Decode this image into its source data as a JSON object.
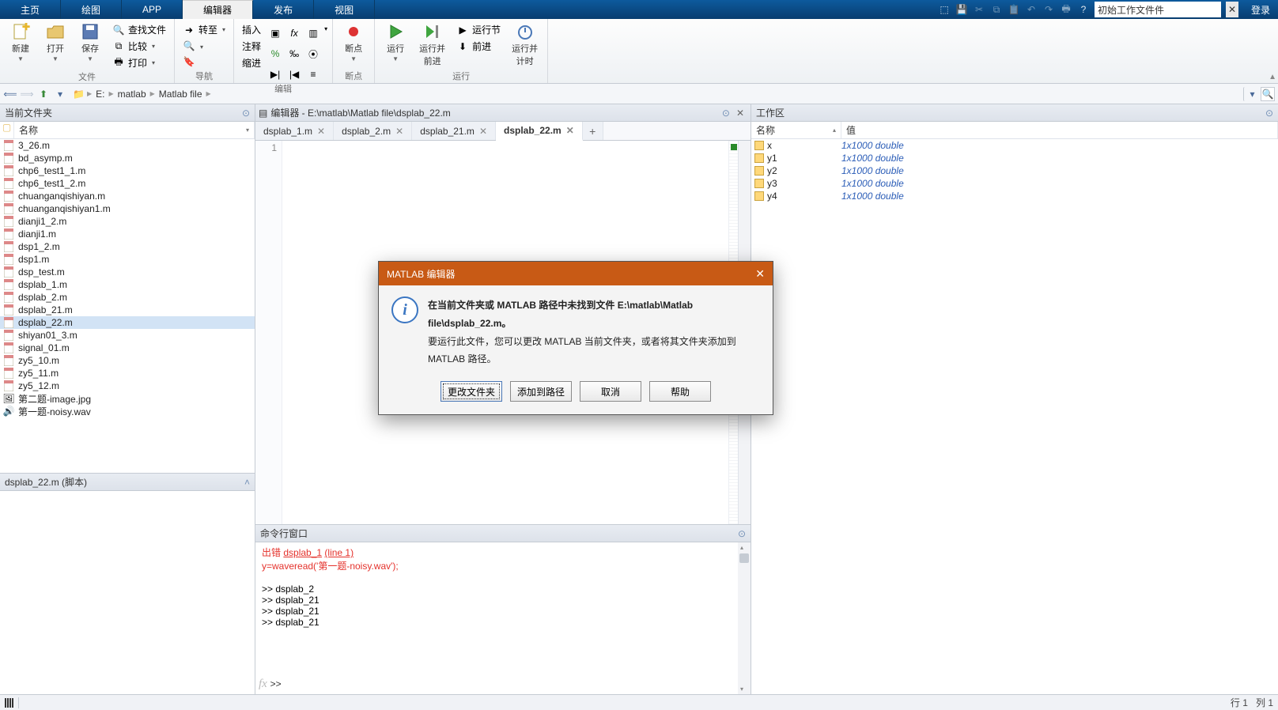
{
  "menu": {
    "tabs": [
      "主页",
      "绘图",
      "APP",
      "编辑器",
      "发布",
      "视图"
    ],
    "active": 3,
    "search_value": "初始工作文件件",
    "login": "登录"
  },
  "ribbon": {
    "file": {
      "label": "文件",
      "new": "新建",
      "open": "打开",
      "save": "保存",
      "findfiles": "查找文件",
      "compare": "比较",
      "print": "打印"
    },
    "nav": {
      "label": "导航",
      "goto": "转至"
    },
    "edit": {
      "label": "编辑",
      "insert": "插入",
      "comment": "注释",
      "indent": "缩进"
    },
    "bp": {
      "label": "断点",
      "bp": "断点"
    },
    "run": {
      "label": "运行",
      "run": "运行",
      "run_advance": "运行并\n前进",
      "run_section": "运行节",
      "advance": "前进",
      "run_time": "运行并\n计时"
    }
  },
  "address": {
    "crumbs": [
      "E:",
      "matlab",
      "Matlab file"
    ]
  },
  "current_folder": {
    "title": "当前文件夹",
    "col_name": "名称",
    "items": [
      {
        "name": "3_26.m",
        "type": "m"
      },
      {
        "name": "bd_asymp.m",
        "type": "m"
      },
      {
        "name": "chp6_test1_1.m",
        "type": "m"
      },
      {
        "name": "chp6_test1_2.m",
        "type": "m"
      },
      {
        "name": "chuanganqishiyan.m",
        "type": "m"
      },
      {
        "name": "chuanganqishiyan1.m",
        "type": "m"
      },
      {
        "name": "dianji1_2.m",
        "type": "m"
      },
      {
        "name": "dianji1.m",
        "type": "m"
      },
      {
        "name": "dsp1_2.m",
        "type": "m"
      },
      {
        "name": "dsp1.m",
        "type": "m"
      },
      {
        "name": "dsp_test.m",
        "type": "m"
      },
      {
        "name": "dsplab_1.m",
        "type": "m"
      },
      {
        "name": "dsplab_2.m",
        "type": "m"
      },
      {
        "name": "dsplab_21.m",
        "type": "m"
      },
      {
        "name": "dsplab_22.m",
        "type": "m",
        "selected": true
      },
      {
        "name": "shiyan01_3.m",
        "type": "m"
      },
      {
        "name": "signal_01.m",
        "type": "m"
      },
      {
        "name": "zy5_10.m",
        "type": "m"
      },
      {
        "name": "zy5_11.m",
        "type": "m"
      },
      {
        "name": "zy5_12.m",
        "type": "m"
      },
      {
        "name": "第二题-image.jpg",
        "type": "img"
      },
      {
        "name": "第一题-noisy.wav",
        "type": "wav"
      }
    ],
    "detail": "dsplab_22.m  (脚本)"
  },
  "editor": {
    "title": "编辑器 - E:\\matlab\\Matlab file\\dsplab_22.m",
    "tabs": [
      "dsplab_1.m",
      "dsplab_2.m",
      "dsplab_21.m",
      "dsplab_22.m"
    ],
    "active": 3,
    "line": "1"
  },
  "cmd": {
    "title": "命令行窗口",
    "err_prefix": "出错",
    "err_link1": "dsplab_1",
    "err_link2": "(line 1)",
    "err_line2": "y=waveread('第一题-noisy.wav');",
    "lines": [
      ">> dsplab_2",
      ">> dsplab_21",
      ">> dsplab_21",
      ">> dsplab_21"
    ],
    "prompt": ">> "
  },
  "workspace": {
    "title": "工作区",
    "col_name": "名称",
    "col_value": "值",
    "vars": [
      {
        "n": "x",
        "v": "1x1000 double"
      },
      {
        "n": "y1",
        "v": "1x1000 double"
      },
      {
        "n": "y2",
        "v": "1x1000 double"
      },
      {
        "n": "y3",
        "v": "1x1000 double"
      },
      {
        "n": "y4",
        "v": "1x1000 double"
      }
    ]
  },
  "dialog": {
    "title": "MATLAB 编辑器",
    "l1a": "在当前文件夹或 MATLAB 路径中未找到文件 ",
    "l1b": "E:\\matlab\\Matlab file\\dsplab_22.m。",
    "l2": "要运行此文件，您可以更改 MATLAB 当前文件夹，或者将其文件夹添加到 MATLAB 路径。",
    "b1": "更改文件夹",
    "b2": "添加到路径",
    "b3": "取消",
    "b4": "帮助"
  },
  "status": {
    "row": "行",
    "row_v": "1",
    "col": "列",
    "col_v": "1"
  }
}
